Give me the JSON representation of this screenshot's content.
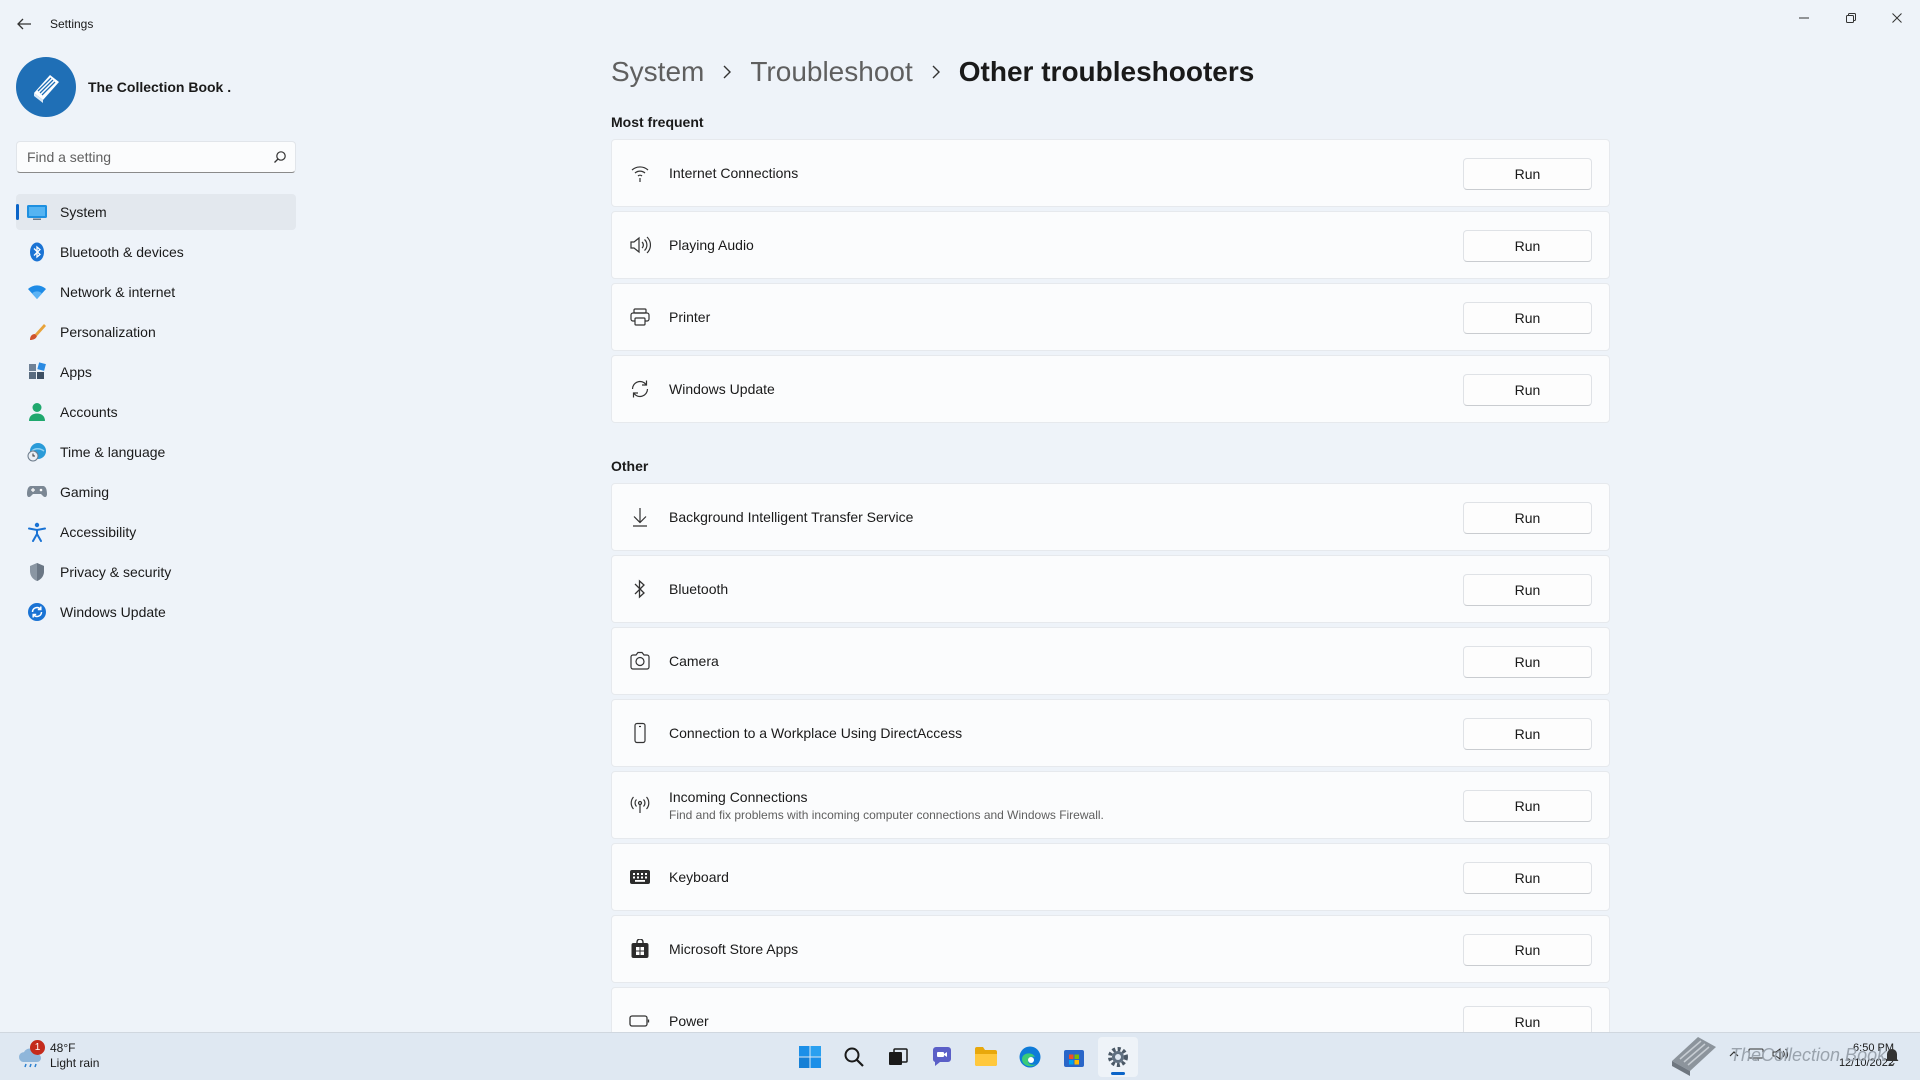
{
  "window": {
    "title": "Settings"
  },
  "profile": {
    "name": "The Collection Book ."
  },
  "search": {
    "placeholder": "Find a setting"
  },
  "nav": {
    "items": [
      {
        "label": "System"
      },
      {
        "label": "Bluetooth & devices"
      },
      {
        "label": "Network & internet"
      },
      {
        "label": "Personalization"
      },
      {
        "label": "Apps"
      },
      {
        "label": "Accounts"
      },
      {
        "label": "Time & language"
      },
      {
        "label": "Gaming"
      },
      {
        "label": "Accessibility"
      },
      {
        "label": "Privacy & security"
      },
      {
        "label": "Windows Update"
      }
    ]
  },
  "breadcrumb": {
    "level1": "System",
    "level2": "Troubleshoot",
    "current": "Other troubleshooters"
  },
  "sections": {
    "frequent": {
      "title": "Most frequent",
      "items": [
        {
          "title": "Internet Connections",
          "icon": "wifi-icon"
        },
        {
          "title": "Playing Audio",
          "icon": "speaker-icon"
        },
        {
          "title": "Printer",
          "icon": "printer-icon"
        },
        {
          "title": "Windows Update",
          "icon": "sync-icon"
        }
      ]
    },
    "other": {
      "title": "Other",
      "items": [
        {
          "title": "Background Intelligent Transfer Service",
          "icon": "download-icon"
        },
        {
          "title": "Bluetooth",
          "icon": "bluetooth-icon"
        },
        {
          "title": "Camera",
          "icon": "camera-icon"
        },
        {
          "title": "Connection to a Workplace Using DirectAccess",
          "icon": "phone-icon"
        },
        {
          "title": "Incoming Connections",
          "desc": "Find and fix problems with incoming computer connections and Windows Firewall.",
          "icon": "antenna-icon"
        },
        {
          "title": "Keyboard",
          "icon": "keyboard-icon"
        },
        {
          "title": "Microsoft Store Apps",
          "icon": "store-icon"
        },
        {
          "title": "Power",
          "icon": "battery-icon"
        }
      ]
    }
  },
  "buttons": {
    "run": "Run"
  },
  "taskbar": {
    "weather_temp": "48°F",
    "weather_desc": "Light rain",
    "weather_badge": "1",
    "time": "6:50 PM",
    "date": "12/10/2022",
    "watermark": "TheCollection Book"
  },
  "colors": {
    "accent": "#0a64c8",
    "background": "#eef3f9",
    "card": "#fbfcfd"
  }
}
